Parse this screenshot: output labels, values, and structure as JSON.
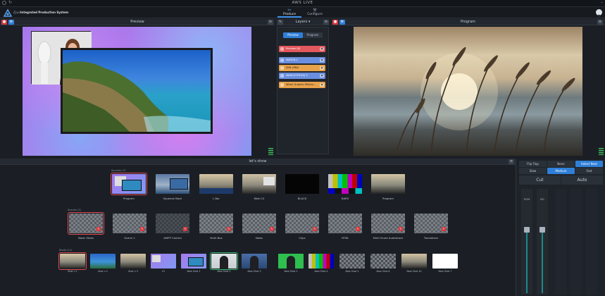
{
  "app": {
    "title": "AWS LIVE",
    "brand_name": "Zyxo",
    "brand_sub": "Integrated Production System"
  },
  "header": {
    "tabs": [
      {
        "label": "Produce",
        "icon": "scissors-icon",
        "active": true
      },
      {
        "label": "Configure",
        "icon": "wrench-icon",
        "active": false
      }
    ]
  },
  "preview": {
    "title": "Preview"
  },
  "layers": {
    "title": "Layers",
    "toggle": [
      "Preview",
      "Program"
    ],
    "items": [
      {
        "label": "Preview (B)",
        "color": "#e2585d"
      },
      {
        "label": "AWSCN-1",
        "color": "#6a8fe0"
      },
      {
        "label": "DYN LPNG",
        "color": "#e8a24a"
      },
      {
        "label": "AWSLIVTHY(HI) 3",
        "color": "#6a8fe0"
      },
      {
        "label": "When Graphic Effects...",
        "color": "#e8a24a"
      }
    ]
  },
  "program": {
    "title": "Program"
  },
  "lets_show": {
    "title": "let's show"
  },
  "sections": {
    "sources_label": "Sources (7)",
    "scenes_label": "Scenes (1)",
    "shots_label": "Shots (11)"
  },
  "sources": [
    {
      "label": "Program"
    },
    {
      "label": "Squeeze Back"
    },
    {
      "label": "L Bar"
    },
    {
      "label": "Web CU"
    },
    {
      "label": "BLACK"
    },
    {
      "label": "BARS"
    },
    {
      "label": "Program"
    }
  ],
  "scenes": [
    {
      "label": "Basic Shots"
    },
    {
      "label": "Scene 1"
    },
    {
      "label": "AMPP Control"
    },
    {
      "label": "Multi Box"
    },
    {
      "label": "News"
    },
    {
      "label": "Clips"
    },
    {
      "label": "HTML"
    },
    {
      "label": "Multi Score Audiotrack"
    },
    {
      "label": "Transitions"
    }
  ],
  "shots": [
    {
      "label": "Shot n 1"
    },
    {
      "label": "Shot n 2"
    },
    {
      "label": "Shot n 3"
    },
    {
      "label": "V1"
    },
    {
      "label": "New Shot 1"
    },
    {
      "label": "New Shot 2"
    },
    {
      "label": "New Shot 3"
    },
    {
      "label": "New Shot 3"
    },
    {
      "label": "New Shot 4"
    },
    {
      "label": "New Shot 5"
    },
    {
      "label": "New Shot 6"
    },
    {
      "label": "New Shot 10"
    },
    {
      "label": "New Shot 7"
    }
  ],
  "transition": {
    "modes": [
      "Flip Flop",
      "None",
      "Select Next"
    ],
    "speeds": [
      "Slow",
      "Medium",
      "Fast"
    ],
    "cut_label": "Cut",
    "auto_label": "Auto",
    "fader_labels": [
      "PGM",
      "BG"
    ]
  }
}
